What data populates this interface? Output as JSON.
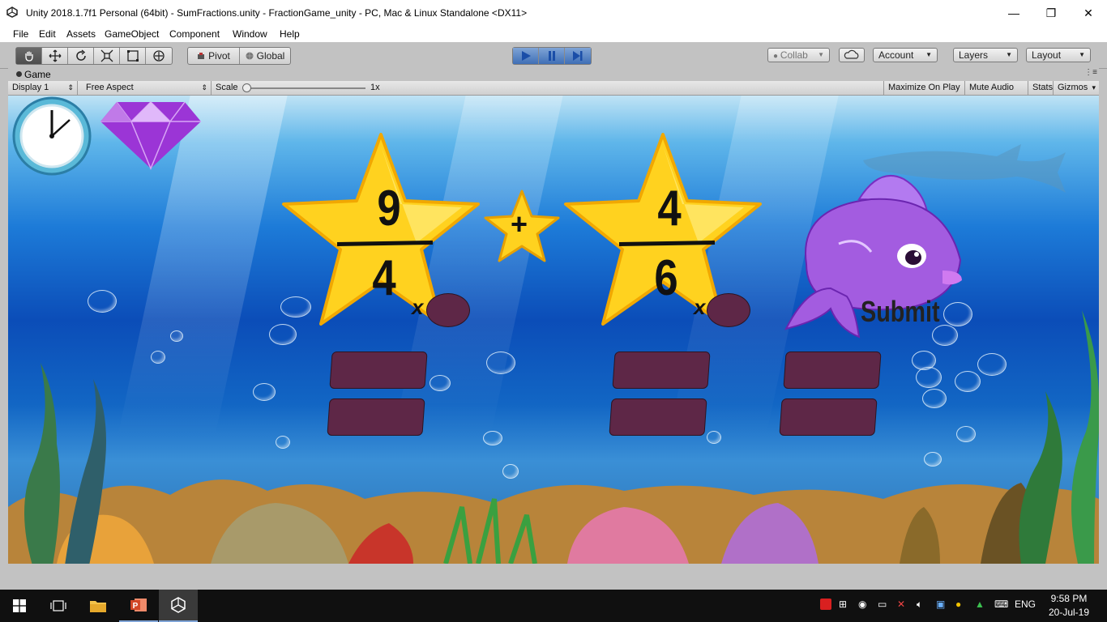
{
  "window": {
    "title": "Unity 2018.1.7f1 Personal (64bit) - SumFractions.unity - FractionGame_unity - PC, Mac & Linux Standalone <DX11>",
    "minimize_glyph": "—",
    "maximize_glyph": "❐",
    "close_glyph": "✕"
  },
  "menu": [
    "File",
    "Edit",
    "Assets",
    "GameObject",
    "Component",
    "Window",
    "Help"
  ],
  "toolbar": {
    "transform_tools": [
      "hand-icon",
      "move-icon",
      "rotate-icon",
      "scale-icon",
      "rect-icon",
      "transform-icon"
    ],
    "pivot_label": "Pivot",
    "global_label": "Global",
    "collab_label": "Collab",
    "account_label": "Account",
    "layers_label": "Layers",
    "layout_label": "Layout",
    "play_state": "playing"
  },
  "game_tab": {
    "label": "Game",
    "display": "Display 1",
    "aspect": "Free Aspect",
    "scale_label": "Scale",
    "scale_value": "1x",
    "maximize_on_play": "Maximize On Play",
    "mute_audio": "Mute Audio",
    "stats": "Stats",
    "gizmos": "Gizmos"
  },
  "game": {
    "fraction1": {
      "numerator": "9",
      "denominator": "4",
      "multiplier_symbol": "x"
    },
    "operator": "+",
    "fraction2": {
      "numerator": "4",
      "denominator": "6",
      "multiplier_symbol": "x"
    },
    "submit_label": "Submit",
    "timer_icon": "clock-icon",
    "gem_icon": "diamond-icon",
    "colors": {
      "star": "#ffd21f",
      "answer_box": "#5e2747",
      "fish": "#a35ce0"
    }
  },
  "taskbar": {
    "apps": [
      "windows-start-icon",
      "task-view-icon",
      "file-explorer-icon",
      "powerpoint-icon",
      "unity-icon"
    ],
    "language": "ENG",
    "time": "9:58 PM",
    "date": "20-Jul-19"
  }
}
